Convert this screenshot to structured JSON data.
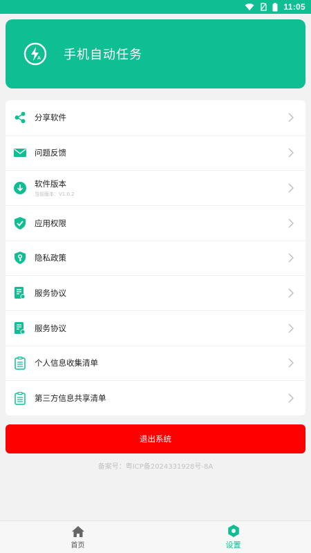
{
  "status_bar": {
    "time": "11:05",
    "icons": [
      "wifi-icon",
      "no-sim-icon",
      "battery-icon"
    ]
  },
  "header": {
    "title": "手机自动任务",
    "icon": "flash-auto-icon"
  },
  "menu": {
    "items": [
      {
        "label": "分享软件",
        "icon": "share-icon"
      },
      {
        "label": "问题反馈",
        "icon": "mail-icon"
      },
      {
        "label": "软件版本",
        "sublabel": "当前版本：V1.0.2",
        "icon": "download-icon"
      },
      {
        "label": "应用权限",
        "icon": "shield-check-icon"
      },
      {
        "label": "隐私政策",
        "icon": "shield-key-icon"
      },
      {
        "label": "服务协议",
        "icon": "document-icon"
      },
      {
        "label": "服务协议",
        "icon": "document-icon"
      },
      {
        "label": "个人信息收集清单",
        "icon": "clipboard-icon"
      },
      {
        "label": "第三方信息共享清单",
        "icon": "clipboard-icon"
      }
    ]
  },
  "logout_label": "退出系统",
  "icp_text": "备案号：粤ICP备2024331928号-8A",
  "tabs": [
    {
      "label": "首页",
      "icon": "home-icon",
      "active": false
    },
    {
      "label": "设置",
      "icon": "settings-icon",
      "active": true
    }
  ],
  "colors": {
    "accent": "#0fbf93",
    "danger": "#ff0000",
    "text": "#222222",
    "muted": "#c2c2c2"
  }
}
